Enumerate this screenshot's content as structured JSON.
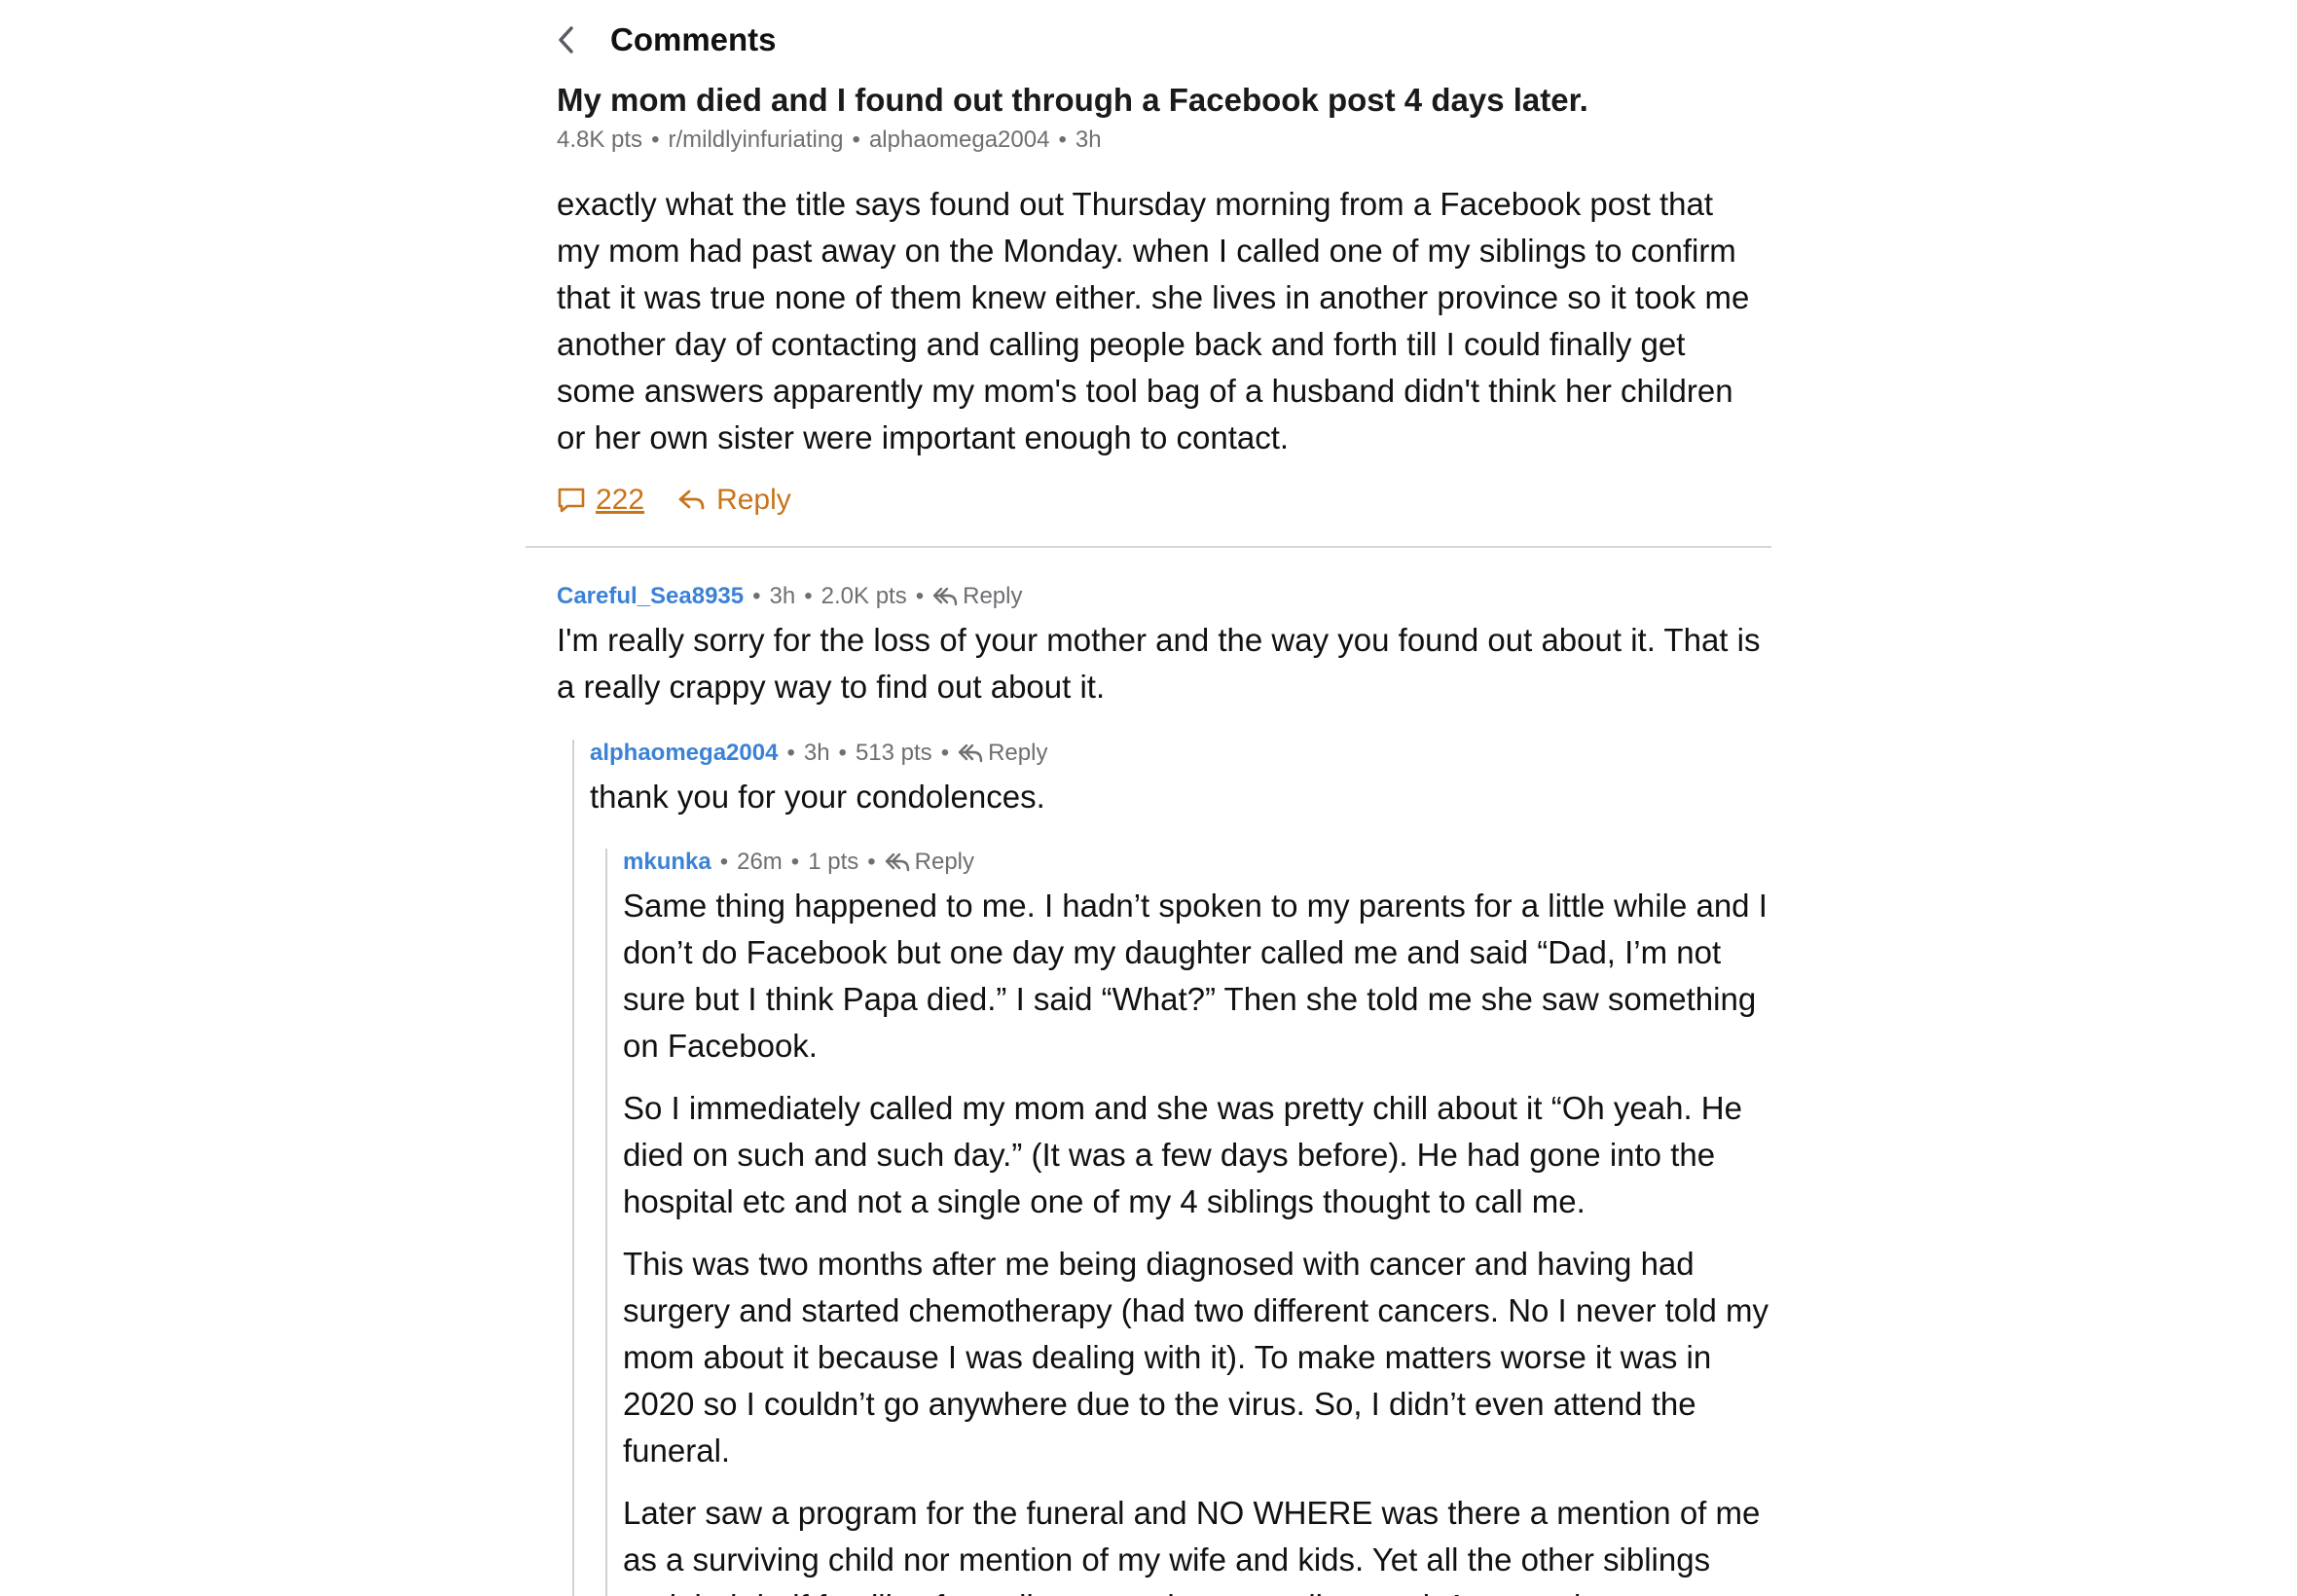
{
  "header": {
    "title": "Comments"
  },
  "post": {
    "title": "My mom died and I found out through a Facebook post 4 days later.",
    "points": "4.8K pts",
    "subreddit": "r/mildlyinfuriating",
    "author": "alphaomega2004",
    "age": "3h",
    "body": "exactly what the title says found out Thursday morning from a Facebook post that my mom had past away on the Monday. when I called one of my siblings to confirm that it was true none of them knew either. she lives in another province so it took me another day of contacting and calling people back and forth till I could finally get some answers apparently my mom's tool bag of a husband didn't think her children or her own sister were important enough to contact.",
    "comment_count": "222",
    "reply_label": "Reply"
  },
  "comments": [
    {
      "author": "Careful_Sea8935",
      "age": "3h",
      "points": "2.0K pts",
      "reply_label": "Reply",
      "body": "I'm really sorry for the loss of your mother and the way you found out about it. That is a really crappy way to find out about it."
    },
    {
      "author": "alphaomega2004",
      "age": "3h",
      "points": "513 pts",
      "reply_label": "Reply",
      "body": "thank you for your condolences."
    },
    {
      "author": "mkunka",
      "age": "26m",
      "points": "1 pts",
      "reply_label": "Reply",
      "paragraphs": [
        "Same thing happened to me. I hadn’t spoken to my parents for a little while and I don’t do Facebook but one day my daughter called me and said “Dad, I’m not sure but I think Papa died.” I said “What?” Then she told me she saw something on Facebook.",
        "So I immediately called my mom and she was pretty chill about it “Oh yeah. He died on such and such day.” (It was a few days before). He had gone into the hospital etc and not a single one of my 4 siblings thought to call me.",
        "This was two months after me being diagnosed with cancer and having had surgery and started chemotherapy (had two different cancers. No I never told my mom about it because I was dealing with it). To make matters worse it was in 2020 so I couldn’t go anywhere due to the virus. So, I didn’t even attend the funeral.",
        "Later saw a program for the funeral and NO WHERE was there a mention of me as a surviving child nor mention of my wife and kids. Yet all the other siblings and their half families from divorce and etc are all named. Anyway, it was"
      ]
    }
  ],
  "colors": {
    "accent_orange": "#c8741a",
    "author_blue": "#3b82d6",
    "meta_gray": "#6e6e73",
    "divider": "#d7d7d7"
  },
  "icons": {
    "back": "chevron-left-icon",
    "comments": "comment-bubble-icon",
    "reply": "reply-arrow-icon"
  }
}
